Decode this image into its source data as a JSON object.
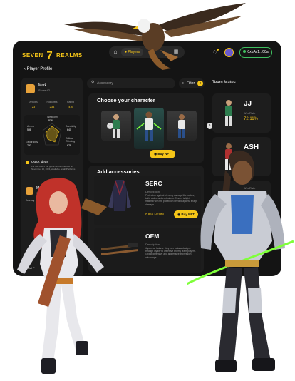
{
  "app": {
    "logo_left": "SEVEN",
    "logo_seven": "7",
    "logo_right": "REALMS",
    "wallet_address": "0xbAc1..f00a"
  },
  "nav": {
    "players_label": "Players"
  },
  "page": {
    "title": "Player Profile"
  },
  "player_card": {
    "name": "Mark",
    "score_label": "Score:42",
    "stats": [
      {
        "label": "Articles",
        "value": "23"
      },
      {
        "label": "Followers",
        "value": "234"
      },
      {
        "label": "Rating",
        "value": "4.8"
      }
    ],
    "radar": {
      "labels": [
        {
          "label": "Weaponry",
          "value": "836"
        },
        {
          "label": "Durability",
          "value": "640"
        },
        {
          "label": "Critical Thinking",
          "value": "678"
        },
        {
          "label": "Geography",
          "value": "793"
        },
        {
          "label": "Ammo",
          "value": "598"
        }
      ]
    }
  },
  "quick_ideas": {
    "title": "Quick ideas",
    "text": "For real use, if the game will be released on November 10, 2024, available on all Platforms"
  },
  "player_card_2": {
    "name": "Mark",
    "score_label": "Score:42",
    "text": "Journey"
  },
  "social_label": "Social P",
  "search": {
    "placeholder": "Accessory"
  },
  "filter": {
    "label": "Filter",
    "count": "2"
  },
  "team_mates_title": "Team Mates",
  "choose_character": {
    "title": "Choose your character",
    "buy_label": "Buy NFT"
  },
  "accessories": {
    "title": "Add accessories",
    "items": [
      {
        "name": "SERC",
        "desc_label": "Description",
        "desc": "Protection against piercing damage like bullets, knife stabs, and explosions. Covers is light material with the protection needed against sharp damage.",
        "price": "0.855 NEUM",
        "buy_label": "Buy NFT"
      },
      {
        "name": "OEM",
        "desc_label": "Description",
        "desc": "Japanese katana. Very rare katana designs through loyalty to offensive enemy team players. Giving defensive and aggressive impression advantage."
      }
    ]
  },
  "team_mates": [
    {
      "name": "JJ",
      "sub": "Win Rate",
      "value": "72.11%"
    },
    {
      "name": "ASH",
      "sub": "",
      "value": ""
    },
    {
      "name": "",
      "sub": "Win Rate",
      "value": ""
    }
  ],
  "colors": {
    "accent": "#f5c518",
    "panel": "#1d1d1d",
    "bg": "#141414",
    "wallet_border": "#3fbf5f"
  }
}
